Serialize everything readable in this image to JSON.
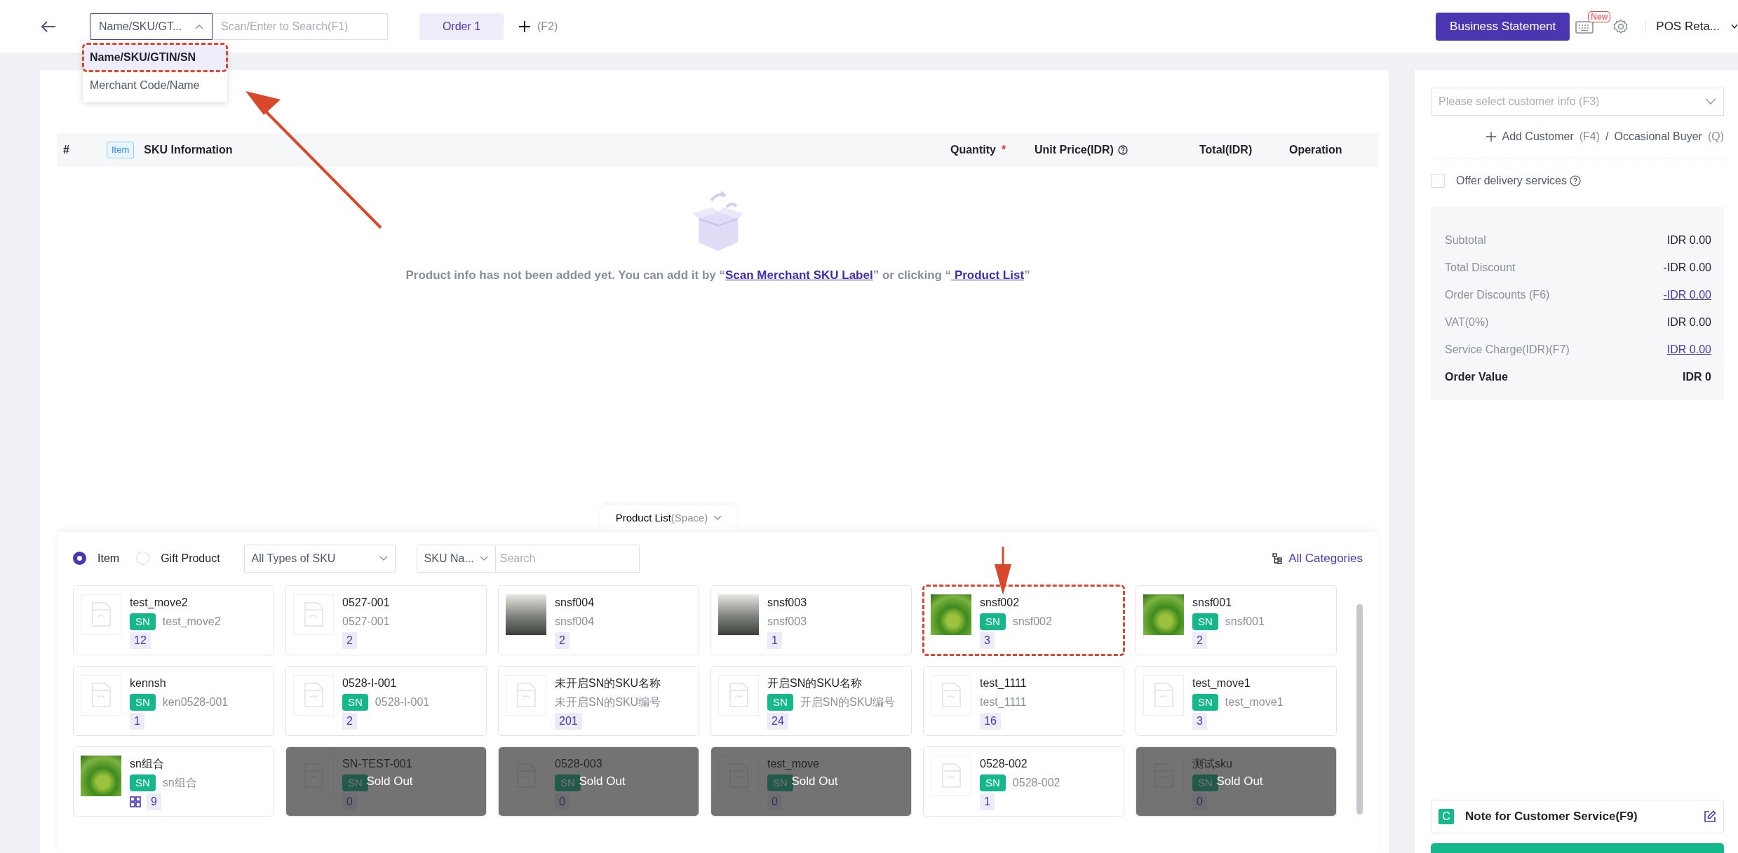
{
  "topbar": {
    "search_type": {
      "value": "Name/SKU/GT...",
      "expanded": true,
      "options": [
        {
          "label": "Name/SKU/GTIN/SN",
          "selected": true,
          "highlighted": true
        },
        {
          "label": "Merchant Code/Name",
          "selected": false,
          "highlighted": false
        }
      ]
    },
    "search": {
      "placeholder": "Scan/Enter to Search(F1)"
    },
    "order_tabs": [
      {
        "label": "Order 1",
        "selected": true
      }
    ],
    "add_order_shortcut": "(F2)",
    "business_statement": "Business Statement",
    "new_badge": "New",
    "store": "POS Reta..."
  },
  "order_table": {
    "columns": [
      {
        "label": "#"
      },
      {
        "label": "SKU Information",
        "tag": "Item"
      },
      {
        "label": "Quantity",
        "required_mark": "*"
      },
      {
        "label": "Unit Price(IDR)",
        "help": true
      },
      {
        "label": "Total(IDR)"
      },
      {
        "label": "Operation"
      }
    ],
    "empty_message": [
      {
        "kind": "text",
        "text": "Product info has not been added yet. You can add it by “"
      },
      {
        "kind": "link",
        "text": "Scan Merchant SKU Label"
      },
      {
        "kind": "text",
        "text": "” or clicking “"
      },
      {
        "kind": "link",
        "text": " Product List"
      },
      {
        "kind": "text",
        "text": "”"
      }
    ]
  },
  "product_list": {
    "tab": "Product List",
    "tab_hint": "(Space)",
    "product_types": [
      {
        "label": "Item",
        "selected": true
      },
      {
        "label": "Gift Product",
        "selected": false
      }
    ],
    "sku_type": "All Types of SKU",
    "search_field": "SKU Na...",
    "search": {
      "placeholder": "Search"
    },
    "categories": "All Categories",
    "products": [
      {
        "name": "test_move2",
        "badge": "SN",
        "code": "test_move2",
        "quantity": "12",
        "kind": "placeholder",
        "highlighted": false
      },
      {
        "name": "0527-001",
        "code": "0527-001",
        "quantity": "2",
        "kind": "placeholder",
        "highlighted": false
      },
      {
        "name": "snsf004",
        "code": "snsf004",
        "quantity": "2",
        "kind": "landscape",
        "highlighted": false
      },
      {
        "name": "snsf003",
        "code": "snsf003",
        "quantity": "1",
        "kind": "landscape",
        "highlighted": false
      },
      {
        "name": "snsf002",
        "badge": "SN",
        "code": "snsf002",
        "quantity": "3",
        "kind": "plant",
        "highlighted": true
      },
      {
        "name": "snsf001",
        "badge": "SN",
        "code": "snsf001",
        "quantity": "2",
        "kind": "plant",
        "highlighted": false
      },
      {
        "name": "kennsh",
        "badge": "SN",
        "code": "ken0528-001",
        "quantity": "1",
        "kind": "placeholder",
        "highlighted": false
      },
      {
        "name": "0528-I-001",
        "badge": "SN",
        "code": "0528-I-001",
        "quantity": "2",
        "kind": "placeholder",
        "highlighted": false
      },
      {
        "name": "未开启SN的SKU名称",
        "code": "未开启SN的SKU编号",
        "quantity": "201",
        "kind": "placeholder",
        "highlighted": false
      },
      {
        "name": "开启SN的SKU名称",
        "badge": "SN",
        "code": "开启SN的SKU编号",
        "quantity": "24",
        "kind": "placeholder",
        "highlighted": false
      },
      {
        "name": "test_1111",
        "code": "test_1111",
        "quantity": "16",
        "kind": "placeholder",
        "highlighted": false
      },
      {
        "name": "test_move1",
        "badge": "SN",
        "code": "test_move1",
        "quantity": "3",
        "kind": "placeholder",
        "highlighted": false
      },
      {
        "name": "sn组合",
        "badge": "SN",
        "code": "sn组合",
        "quantity": "9",
        "kind": "plant",
        "bundle": true,
        "highlighted": false
      },
      {
        "name": "SN-TEST-001",
        "badge": "SN",
        "quantity": "0",
        "kind": "placeholder",
        "status": "Sold Out",
        "highlighted": false
      },
      {
        "name": "0528-003",
        "badge": "SN",
        "quantity": "0",
        "kind": "placeholder",
        "status": "Sold Out",
        "highlighted": false
      },
      {
        "name": "test_move",
        "badge": "SN",
        "quantity": "0",
        "kind": "placeholder",
        "status": "Sold Out",
        "highlighted": false
      },
      {
        "name": "0528-002",
        "badge": "SN",
        "code": "0528-002",
        "quantity": "1",
        "kind": "placeholder",
        "highlighted": false
      },
      {
        "name": "测试sku",
        "badge": "SN",
        "quantity": "0",
        "kind": "placeholder",
        "status": "Sold Out",
        "highlighted": false
      }
    ]
  },
  "customer": {
    "placeholder": "Please select customer info (F3)",
    "add_customer": "Add Customer",
    "add_shortcut": "(F4)",
    "separator": "/",
    "occasional_buyer": "Occasional Buyer",
    "occasional_shortcut": "(Q)",
    "delivery": {
      "label": "Offer delivery services",
      "checked": false
    }
  },
  "summary": [
    {
      "label": "Subtotal",
      "value": "IDR 0.00",
      "kind": "plain"
    },
    {
      "label": "Total Discount",
      "value": "-IDR 0.00",
      "kind": "plain"
    },
    {
      "label": "Order Discounts (F6)",
      "value": "-IDR 0.00",
      "kind": "link"
    },
    {
      "label": "VAT(0%)",
      "value": "IDR 0.00",
      "kind": "plain"
    },
    {
      "label": "Service Charge(IDR)(F7)",
      "value": "IDR 0.00",
      "kind": "link"
    },
    {
      "label": "Order Value",
      "value": "IDR 0",
      "kind": "total"
    }
  ],
  "note": {
    "badge": "C",
    "label": "Note for Customer Service(F9)"
  }
}
